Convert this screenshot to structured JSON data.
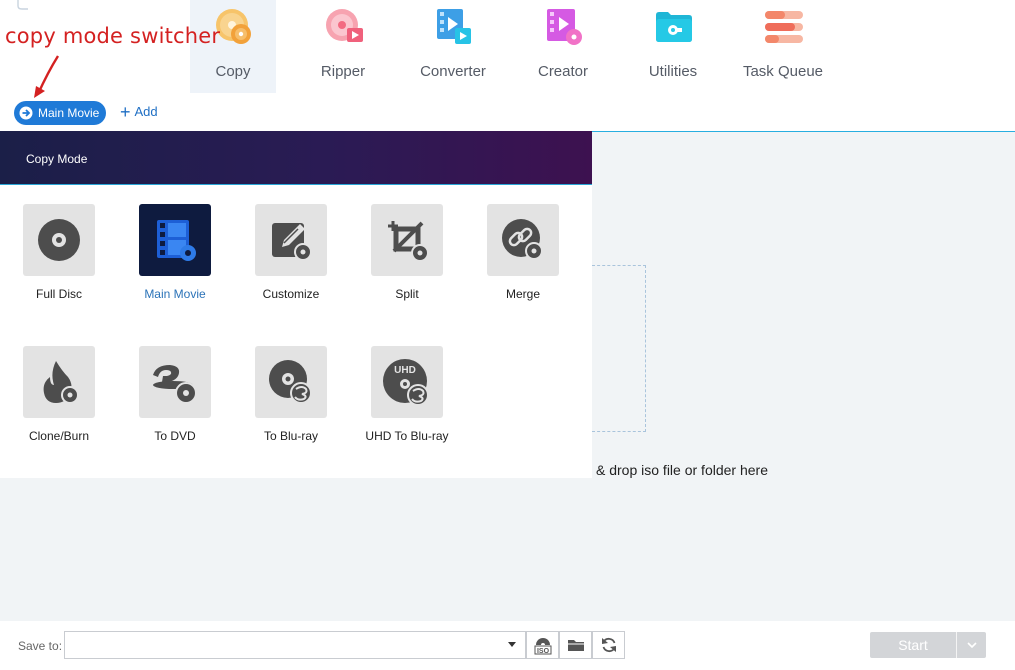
{
  "annotation": {
    "text": "copy mode switcher",
    "color": "#d42121"
  },
  "nav": {
    "items": [
      {
        "label": "Copy",
        "icon": "copy-disc-icon",
        "active": true
      },
      {
        "label": "Ripper",
        "icon": "ripper-icon"
      },
      {
        "label": "Converter",
        "icon": "converter-icon"
      },
      {
        "label": "Creator",
        "icon": "creator-icon"
      },
      {
        "label": "Utilities",
        "icon": "utilities-icon"
      },
      {
        "label": "Task Queue",
        "icon": "task-queue-icon"
      }
    ]
  },
  "toolbar": {
    "mode_button_label": "Main Movie",
    "add_label": "Add"
  },
  "copy_mode": {
    "title": "Copy Mode",
    "modes": [
      {
        "label": "Full Disc",
        "icon": "full-disc-icon"
      },
      {
        "label": "Main Movie",
        "icon": "main-movie-icon",
        "selected": true
      },
      {
        "label": "Customize",
        "icon": "customize-icon"
      },
      {
        "label": "Split",
        "icon": "split-icon"
      },
      {
        "label": "Merge",
        "icon": "merge-icon"
      },
      {
        "label": "Clone/Burn",
        "icon": "clone-burn-icon"
      },
      {
        "label": "To DVD",
        "icon": "to-dvd-icon"
      },
      {
        "label": "To Blu-ray",
        "icon": "to-bluray-icon"
      },
      {
        "label": "UHD To Blu-ray",
        "icon": "uhd-to-bluray-icon",
        "badge": "UHD"
      }
    ]
  },
  "drop_area": {
    "text": "& drop iso file or folder here"
  },
  "bottom": {
    "save_to_label": "Save to:",
    "save_path": "",
    "iso_badge": "ISO",
    "start_label": "Start"
  },
  "colors": {
    "accent": "#1f7ad7",
    "header_gradient_start": "#1b1f48",
    "header_gradient_end": "#3d1150",
    "start_disabled": "#d3d5d8"
  }
}
